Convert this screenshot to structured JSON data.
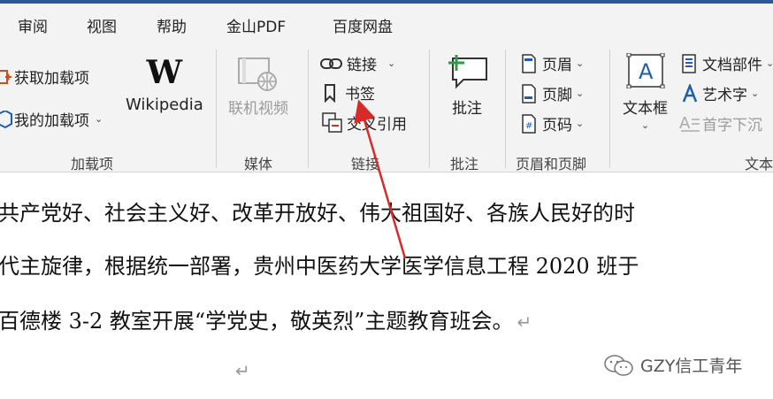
{
  "tabs": [
    "审阅",
    "视图",
    "帮助",
    "金山PDF",
    "百度网盘"
  ],
  "groups": {
    "addins": {
      "label": "加载项",
      "get": "获取加载项",
      "mine": "我的加载项",
      "wikipedia": "Wikipedia"
    },
    "media": {
      "label": "媒体",
      "video": "联机视频"
    },
    "links": {
      "label": "链接",
      "link": "链接",
      "bookmark": "书签",
      "crossref": "交叉引用"
    },
    "comments": {
      "label": "批注",
      "comment": "批注"
    },
    "header_footer": {
      "label": "页眉和页脚",
      "header": "页眉",
      "footer": "页脚",
      "page_number": "页码"
    },
    "text": {
      "label": "文本",
      "textbox": "文本框",
      "parts": "文档部件",
      "wordart": "艺术字",
      "dropcap": "首字下沉"
    }
  },
  "document": {
    "lines": [
      "共产党好、社会主义好、改革开放好、伟大祖国好、各族人民好的时",
      "代主旋律，根据统一部署，贵州中医药大学医学信息工程 2020 班于",
      "百德楼 3-2 教室开展“学党史，敬英烈”主题教育班会。"
    ],
    "paragraph_mark": "↵"
  },
  "watermark": "GZY信工青年",
  "colors": {
    "accent": "#2b579a",
    "arrow": "#d62b2b",
    "icon_blue": "#1f5fa8",
    "icon_orange": "#d14b1f"
  }
}
